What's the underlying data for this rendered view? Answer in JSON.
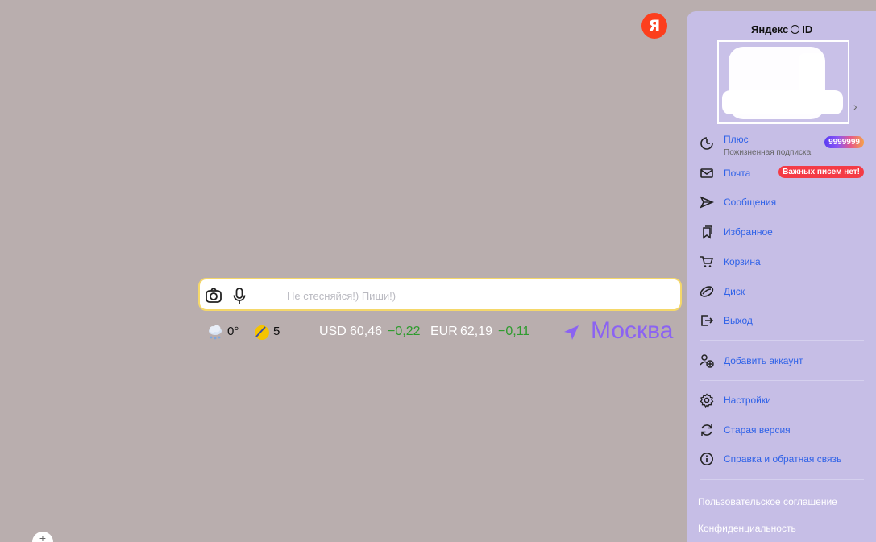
{
  "logo": {
    "letter": "Я"
  },
  "search": {
    "placeholder": "Не стесняйся!) Пиши!)",
    "value": ""
  },
  "info": {
    "temperature": "0°",
    "magnetic": "5",
    "usd_label": "USD",
    "usd_value": "60,46",
    "usd_change": "−0,22",
    "eur_label": "EUR",
    "eur_value": "62,19",
    "eur_change": "−0,11",
    "city": "Москва"
  },
  "panel": {
    "title_left": "Яндекс",
    "title_right": "ID",
    "menu": [
      {
        "label": "Плюс",
        "sub": "Пожизненная подписка",
        "badge": "9999999",
        "icon": "plus-icon"
      },
      {
        "label": "Почта",
        "badge": "Важных писем нет!",
        "icon": "mail-icon"
      },
      {
        "label": "Сообщения",
        "icon": "messages-icon"
      },
      {
        "label": "Избранное",
        "icon": "bookmarks-icon"
      },
      {
        "label": "Корзина",
        "icon": "cart-icon"
      },
      {
        "label": "Диск",
        "icon": "disk-icon"
      },
      {
        "label": "Выход",
        "icon": "logout-icon"
      },
      {
        "label": "Добавить аккаунт",
        "icon": "add-account-icon"
      },
      {
        "label": "Настройки",
        "icon": "gear-icon"
      },
      {
        "label": "Старая версия",
        "icon": "refresh-icon"
      },
      {
        "label": "Справка и обратная связь",
        "icon": "info-icon"
      }
    ],
    "footer": [
      "Пользовательское соглашение",
      "Конфиденциальность"
    ]
  },
  "colors": {
    "background": "#b9aeae",
    "panel": "#c6bee6",
    "link": "#2f62e8",
    "city": "#8b63f2",
    "change": "#2e9b2e"
  }
}
